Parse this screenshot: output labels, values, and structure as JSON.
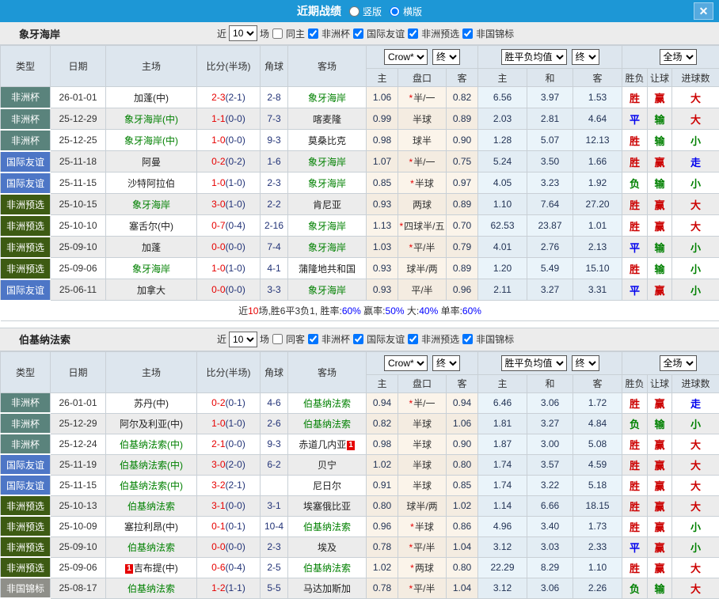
{
  "titlebar": {
    "title": "近期战绩",
    "radio_vertical": "竖版",
    "radio_horizontal": "横版",
    "close": "✕",
    "bar_color": "#1d97d6"
  },
  "columns": {
    "type": "类型",
    "date": "日期",
    "home": "主场",
    "score": "比分(半场)",
    "corners": "角球",
    "away": "客场",
    "odds_home": "主",
    "handicap": "盘口",
    "odds_away": "客",
    "avg_home": "主",
    "avg_draw": "和",
    "avg_away": "客",
    "wdl": "胜负",
    "hcp": "让球",
    "goals": "进球数"
  },
  "selects": {
    "source": "Crow*",
    "source_time": "终",
    "avg": "胜平负均值",
    "avg_time": "终",
    "scope": "全场"
  },
  "league_colors": {
    "非洲杯": "#5a837c",
    "国际友谊": "#4d76c6",
    "非洲预选": "#3d5b13",
    "非国锦标": "#8f8f89"
  },
  "result_colors": {
    "胜": "#cc0000",
    "平": "#0000ee",
    "负": "#008000",
    "赢": "#cc0000",
    "输": "#008000",
    "大": "#cc0000",
    "小": "#008000",
    "走": "#0000ee"
  },
  "tables": [
    {
      "team": "象牙海岸",
      "filter": {
        "near": "近",
        "count": "10",
        "games": "场",
        "same": "同主",
        "leagues": [
          "非洲杯",
          "国际友谊",
          "非洲预选",
          "非国锦标"
        ]
      },
      "rows": [
        {
          "league": "非洲杯",
          "date": "26-01-01",
          "home": "加蓬(中)",
          "home_green": false,
          "score": "2-3",
          "half": "(2-1)",
          "corners": "2-8",
          "away": "象牙海岸",
          "away_green": true,
          "odds_h": "1.06",
          "star": true,
          "handicap": "半/一",
          "odds_a": "0.82",
          "avg_h": "6.56",
          "avg_d": "3.97",
          "avg_a": "1.53",
          "wdl": "胜",
          "hcp": "赢",
          "goals": "大"
        },
        {
          "league": "非洲杯",
          "date": "25-12-29",
          "home": "象牙海岸(中)",
          "home_green": true,
          "score": "1-1",
          "half": "(0-0)",
          "corners": "7-3",
          "away": "喀麦隆",
          "away_green": false,
          "odds_h": "0.99",
          "star": false,
          "handicap": "半球",
          "odds_a": "0.89",
          "avg_h": "2.03",
          "avg_d": "2.81",
          "avg_a": "4.64",
          "wdl": "平",
          "hcp": "输",
          "goals": "大"
        },
        {
          "league": "非洲杯",
          "date": "25-12-25",
          "home": "象牙海岸(中)",
          "home_green": true,
          "score": "1-0",
          "half": "(0-0)",
          "corners": "9-3",
          "away": "莫桑比克",
          "away_green": false,
          "odds_h": "0.98",
          "star": false,
          "handicap": "球半",
          "odds_a": "0.90",
          "avg_h": "1.28",
          "avg_d": "5.07",
          "avg_a": "12.13",
          "wdl": "胜",
          "hcp": "输",
          "goals": "小"
        },
        {
          "league": "国际友谊",
          "date": "25-11-18",
          "home": "阿曼",
          "home_green": false,
          "score": "0-2",
          "half": "(0-2)",
          "corners": "1-6",
          "away": "象牙海岸",
          "away_green": true,
          "odds_h": "1.07",
          "star": true,
          "handicap": "半/一",
          "odds_a": "0.75",
          "avg_h": "5.24",
          "avg_d": "3.50",
          "avg_a": "1.66",
          "wdl": "胜",
          "hcp": "赢",
          "goals": "走"
        },
        {
          "league": "国际友谊",
          "date": "25-11-15",
          "home": "沙特阿拉伯",
          "home_green": false,
          "score": "1-0",
          "half": "(1-0)",
          "corners": "2-3",
          "away": "象牙海岸",
          "away_green": true,
          "odds_h": "0.85",
          "star": true,
          "handicap": "半球",
          "odds_a": "0.97",
          "avg_h": "4.05",
          "avg_d": "3.23",
          "avg_a": "1.92",
          "wdl": "负",
          "hcp": "输",
          "goals": "小"
        },
        {
          "league": "非洲预选",
          "date": "25-10-15",
          "home": "象牙海岸",
          "home_green": true,
          "score": "3-0",
          "half": "(1-0)",
          "corners": "2-2",
          "away": "肯尼亚",
          "away_green": false,
          "odds_h": "0.93",
          "star": false,
          "handicap": "两球",
          "odds_a": "0.89",
          "avg_h": "1.10",
          "avg_d": "7.64",
          "avg_a": "27.20",
          "wdl": "胜",
          "hcp": "赢",
          "goals": "大"
        },
        {
          "league": "非洲预选",
          "date": "25-10-10",
          "home": "塞舌尔(中)",
          "home_green": false,
          "score": "0-7",
          "half": "(0-4)",
          "corners": "2-16",
          "away": "象牙海岸",
          "away_green": true,
          "odds_h": "1.13",
          "star": true,
          "handicap": "四球半/五",
          "odds_a": "0.70",
          "avg_h": "62.53",
          "avg_d": "23.87",
          "avg_a": "1.01",
          "wdl": "胜",
          "hcp": "赢",
          "goals": "大"
        },
        {
          "league": "非洲预选",
          "date": "25-09-10",
          "home": "加蓬",
          "home_green": false,
          "score": "0-0",
          "half": "(0-0)",
          "corners": "7-4",
          "away": "象牙海岸",
          "away_green": true,
          "odds_h": "1.03",
          "star": true,
          "handicap": "平/半",
          "odds_a": "0.79",
          "avg_h": "4.01",
          "avg_d": "2.76",
          "avg_a": "2.13",
          "wdl": "平",
          "hcp": "输",
          "goals": "小"
        },
        {
          "league": "非洲预选",
          "date": "25-09-06",
          "home": "象牙海岸",
          "home_green": true,
          "score": "1-0",
          "half": "(1-0)",
          "corners": "4-1",
          "away": "蒲隆地共和国",
          "away_green": false,
          "odds_h": "0.93",
          "star": false,
          "handicap": "球半/两",
          "odds_a": "0.89",
          "avg_h": "1.20",
          "avg_d": "5.49",
          "avg_a": "15.10",
          "wdl": "胜",
          "hcp": "输",
          "goals": "小"
        },
        {
          "league": "国际友谊",
          "date": "25-06-11",
          "home": "加拿大",
          "home_green": false,
          "score": "0-0",
          "half": "(0-0)",
          "corners": "3-3",
          "away": "象牙海岸",
          "away_green": true,
          "odds_h": "0.93",
          "star": false,
          "handicap": "平/半",
          "odds_a": "0.96",
          "avg_h": "2.11",
          "avg_d": "3.27",
          "avg_a": "3.31",
          "wdl": "平",
          "hcp": "赢",
          "goals": "小"
        }
      ],
      "summary": [
        {
          "text": "近",
          "color": "#333333"
        },
        {
          "text": "10",
          "color": "#e60000"
        },
        {
          "text": "场,胜6平3负1, 胜率:",
          "color": "#333333"
        },
        {
          "text": "60%",
          "color": "#0000ff"
        },
        {
          "text": " 赢率:",
          "color": "#333333"
        },
        {
          "text": "50%",
          "color": "#0000ff"
        },
        {
          "text": " 大:",
          "color": "#333333"
        },
        {
          "text": "40%",
          "color": "#0000ff"
        },
        {
          "text": " 单率:",
          "color": "#333333"
        },
        {
          "text": "60%",
          "color": "#0000ff"
        }
      ]
    },
    {
      "team": "伯基纳法索",
      "filter": {
        "near": "近",
        "count": "10",
        "games": "场",
        "same": "同客",
        "leagues": [
          "非洲杯",
          "国际友谊",
          "非洲预选",
          "非国锦标"
        ]
      },
      "rows": [
        {
          "league": "非洲杯",
          "date": "26-01-01",
          "home": "苏丹(中)",
          "home_green": false,
          "score": "0-2",
          "half": "(0-1)",
          "corners": "4-6",
          "away": "伯基纳法索",
          "away_green": true,
          "odds_h": "0.94",
          "star": true,
          "handicap": "半/一",
          "odds_a": "0.94",
          "avg_h": "6.46",
          "avg_d": "3.06",
          "avg_a": "1.72",
          "wdl": "胜",
          "hcp": "赢",
          "goals": "走"
        },
        {
          "league": "非洲杯",
          "date": "25-12-29",
          "home": "阿尔及利亚(中)",
          "home_green": false,
          "score": "1-0",
          "half": "(1-0)",
          "corners": "2-6",
          "away": "伯基纳法索",
          "away_green": true,
          "odds_h": "0.82",
          "star": false,
          "handicap": "半球",
          "odds_a": "1.06",
          "avg_h": "1.81",
          "avg_d": "3.27",
          "avg_a": "4.84",
          "wdl": "负",
          "hcp": "输",
          "goals": "小"
        },
        {
          "league": "非洲杯",
          "date": "25-12-24",
          "home": "伯基纳法索(中)",
          "home_green": true,
          "score": "2-1",
          "half": "(0-0)",
          "corners": "9-3",
          "away": "赤道几内亚",
          "away_green": false,
          "away_badge": "1",
          "odds_h": "0.98",
          "star": false,
          "handicap": "半球",
          "odds_a": "0.90",
          "avg_h": "1.87",
          "avg_d": "3.00",
          "avg_a": "5.08",
          "wdl": "胜",
          "hcp": "赢",
          "goals": "大"
        },
        {
          "league": "国际友谊",
          "date": "25-11-19",
          "home": "伯基纳法索(中)",
          "home_green": true,
          "score": "3-0",
          "half": "(2-0)",
          "corners": "6-2",
          "away": "贝宁",
          "away_green": false,
          "odds_h": "1.02",
          "star": false,
          "handicap": "半球",
          "odds_a": "0.80",
          "avg_h": "1.74",
          "avg_d": "3.57",
          "avg_a": "4.59",
          "wdl": "胜",
          "hcp": "赢",
          "goals": "大"
        },
        {
          "league": "国际友谊",
          "date": "25-11-15",
          "home": "伯基纳法索(中)",
          "home_green": true,
          "score": "3-2",
          "half": "(2-1)",
          "corners": "",
          "away": "尼日尔",
          "away_green": false,
          "odds_h": "0.91",
          "star": false,
          "handicap": "半球",
          "odds_a": "0.85",
          "avg_h": "1.74",
          "avg_d": "3.22",
          "avg_a": "5.18",
          "wdl": "胜",
          "hcp": "赢",
          "goals": "大"
        },
        {
          "league": "非洲预选",
          "date": "25-10-13",
          "home": "伯基纳法索",
          "home_green": true,
          "score": "3-1",
          "half": "(0-0)",
          "corners": "3-1",
          "away": "埃塞俄比亚",
          "away_green": false,
          "odds_h": "0.80",
          "star": false,
          "handicap": "球半/两",
          "odds_a": "1.02",
          "avg_h": "1.14",
          "avg_d": "6.66",
          "avg_a": "18.15",
          "wdl": "胜",
          "hcp": "赢",
          "goals": "大"
        },
        {
          "league": "非洲预选",
          "date": "25-10-09",
          "home": "塞拉利昂(中)",
          "home_green": false,
          "score": "0-1",
          "half": "(0-1)",
          "corners": "10-4",
          "away": "伯基纳法索",
          "away_green": true,
          "odds_h": "0.96",
          "star": true,
          "handicap": "半球",
          "odds_a": "0.86",
          "avg_h": "4.96",
          "avg_d": "3.40",
          "avg_a": "1.73",
          "wdl": "胜",
          "hcp": "赢",
          "goals": "小"
        },
        {
          "league": "非洲预选",
          "date": "25-09-10",
          "home": "伯基纳法索",
          "home_green": true,
          "score": "0-0",
          "half": "(0-0)",
          "corners": "2-3",
          "away": "埃及",
          "away_green": false,
          "odds_h": "0.78",
          "star": true,
          "handicap": "平/半",
          "odds_a": "1.04",
          "avg_h": "3.12",
          "avg_d": "3.03",
          "avg_a": "2.33",
          "wdl": "平",
          "hcp": "赢",
          "goals": "小"
        },
        {
          "league": "非洲预选",
          "date": "25-09-06",
          "home": "吉布提(中)",
          "home_green": false,
          "home_badge": "1",
          "score": "0-6",
          "half": "(0-4)",
          "corners": "2-5",
          "away": "伯基纳法索",
          "away_green": true,
          "odds_h": "1.02",
          "star": true,
          "handicap": "两球",
          "odds_a": "0.80",
          "avg_h": "22.29",
          "avg_d": "8.29",
          "avg_a": "1.10",
          "wdl": "胜",
          "hcp": "赢",
          "goals": "大"
        },
        {
          "league": "非国锦标",
          "date": "25-08-17",
          "home": "伯基纳法索",
          "home_green": true,
          "score": "1-2",
          "half": "(1-1)",
          "corners": "5-5",
          "away": "马达加斯加",
          "away_green": false,
          "odds_h": "0.78",
          "star": true,
          "handicap": "平/半",
          "odds_a": "1.04",
          "avg_h": "3.12",
          "avg_d": "3.06",
          "avg_a": "2.26",
          "wdl": "负",
          "hcp": "输",
          "goals": "大"
        }
      ]
    }
  ]
}
